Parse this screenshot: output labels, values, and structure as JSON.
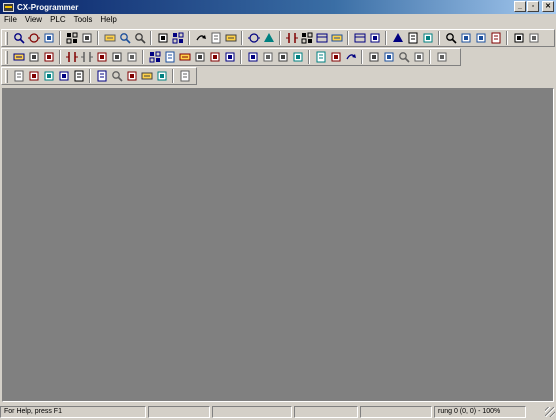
{
  "window": {
    "title": "CX-Programmer",
    "controls": [
      "minimize-icon",
      "restore-icon",
      "close-icon"
    ]
  },
  "menu": [
    "File",
    "View",
    "PLC",
    "Tools",
    "Help"
  ],
  "toolbars": {
    "row1": [
      "new-icon",
      "open-icon",
      "save-icon",
      "sep",
      "print-icon",
      "print-preview-icon",
      "sep",
      "cut-icon",
      "copy-icon",
      "paste-icon",
      "sep",
      "undo-icon",
      "redo-icon",
      "sep",
      "find-icon",
      "replace-icon",
      "goto-icon",
      "sep",
      "about-icon",
      "context-help-icon",
      "sep",
      "online-icon",
      "monitor-icon",
      "transfer-to-plc-icon",
      "transfer-from-plc-icon",
      "sep",
      "run-icon",
      "pause-icon",
      "sep",
      "compare-icon",
      "mode-icon",
      "change-icon",
      "sep",
      "program-icon",
      "debug-icon",
      "monitor-mode-icon",
      "run-mode-icon",
      "sep",
      "force-on-icon",
      "force-off-icon"
    ],
    "row2": [
      "zoom-icon",
      "zoom-in-icon",
      "zoom-out-icon",
      "sep",
      "grid-icon",
      "show-comments-icon",
      "list-icon",
      "rung-icon",
      "table-icon",
      "sep",
      "select-icon",
      "contact-icon",
      "contact-nc-icon",
      "contact-or-icon",
      "contact-or-nc-icon",
      "vertical-line-icon",
      "sep",
      "horizontal-line-icon",
      "coil-icon",
      "coil-nc-icon",
      "instruction-icon",
      "sep",
      "online-edit-icon",
      "cancel-edit-icon",
      "end-edit-icon",
      "sep",
      "set-value-icon",
      "change-value-icon",
      "differentiate-icon",
      "forced-status-icon",
      "sep",
      "cycle-time-icon"
    ],
    "row3": [
      "project-workspace-icon",
      "output-window-icon",
      "watch-window-icon",
      "address-ref-icon",
      "properties-icon",
      "sep",
      "cross-ref-icon",
      "data-trace-icon",
      "time-chart-icon",
      "memory-icon",
      "io-table-icon",
      "sep",
      "hex-display-icon"
    ]
  },
  "status": {
    "help_text": "For Help, press F1",
    "position_text": "rung 0 (0, 0)  - 100%"
  }
}
